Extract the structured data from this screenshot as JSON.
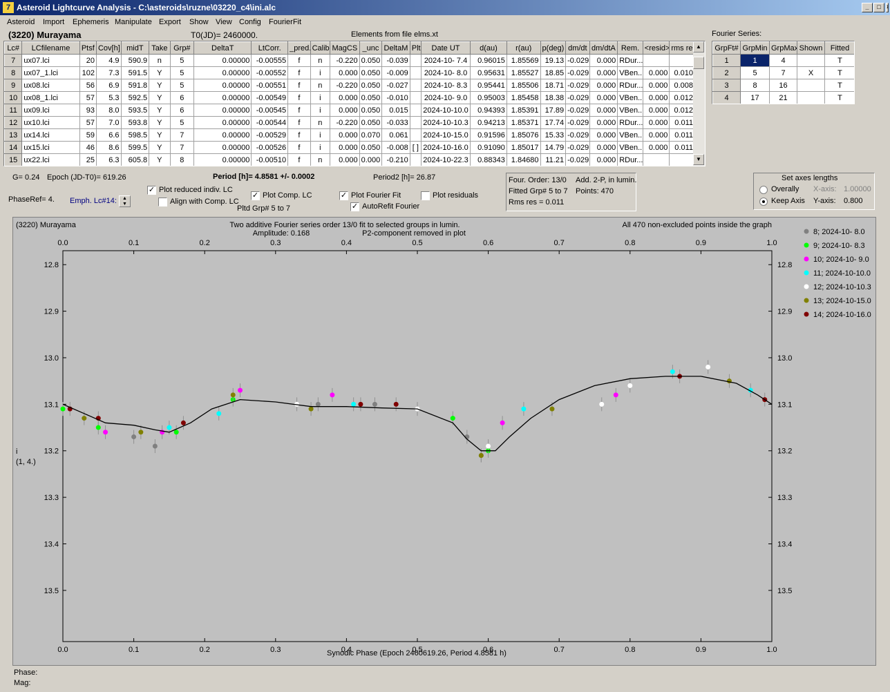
{
  "window": {
    "title": "Asteroid Lightcurve Analysis - C:\\asteroids\\ruzne\\03220_c4\\ini.alc",
    "icon_glyph": "7",
    "buttons": [
      "_",
      "□",
      "×"
    ]
  },
  "menu": [
    "Asteroid",
    "Import",
    "Ephemeris",
    "Manipulate",
    "Export",
    "Show",
    "View",
    "Config",
    "FourierFit"
  ],
  "header": {
    "asteroid": "(3220) Murayama",
    "t0": "T0(JD)= 2460000.",
    "elements": "Elements from file elms.xt",
    "fourier_label": "Fourier Series:"
  },
  "table": {
    "columns": [
      "Lc#",
      "LCfilename",
      "Ptsf",
      "Cov[h]",
      "midT",
      "Take",
      "Grp#",
      "DeltaT",
      "LtCorr.",
      "_pred.",
      "Calib.",
      "MagCS",
      "_unc",
      "DeltaM",
      "Plt",
      "Date UT",
      "d(au)",
      "r(au)",
      "p(deg)",
      "dm/dt",
      "dm/dtA",
      "Rem.",
      "<resid>",
      "rms res"
    ],
    "rows": [
      [
        "7",
        "ux07.lci",
        "20",
        "4.9",
        "590.9",
        "n",
        "5",
        "0.00000",
        "-0.00555",
        "f",
        "n",
        "-0.220",
        "0.050",
        "-0.039",
        "",
        "2024-10- 7.4",
        "0.96015",
        "1.85569",
        "19.13",
        "-0.029",
        "0.000",
        "RDur...",
        "",
        ""
      ],
      [
        "8",
        "ux07_1.lci",
        "102",
        "7.3",
        "591.5",
        "Y",
        "5",
        "0.00000",
        "-0.00552",
        "f",
        "i",
        "0.000",
        "0.050",
        "-0.009",
        "",
        "2024-10- 8.0",
        "0.95631",
        "1.85527",
        "18.85",
        "-0.029",
        "0.000",
        "VBen...",
        "0.000",
        "0.010"
      ],
      [
        "9",
        "ux08.lci",
        "56",
        "6.9",
        "591.8",
        "Y",
        "5",
        "0.00000",
        "-0.00551",
        "f",
        "n",
        "-0.220",
        "0.050",
        "-0.027",
        "",
        "2024-10- 8.3",
        "0.95441",
        "1.85506",
        "18.71",
        "-0.029",
        "0.000",
        "RDur...",
        "0.000",
        "0.008"
      ],
      [
        "10",
        "ux08_1.lci",
        "57",
        "5.3",
        "592.5",
        "Y",
        "6",
        "0.00000",
        "-0.00549",
        "f",
        "i",
        "0.000",
        "0.050",
        "-0.010",
        "",
        "2024-10- 9.0",
        "0.95003",
        "1.85458",
        "18.38",
        "-0.029",
        "0.000",
        "VBen...",
        "0.000",
        "0.012"
      ],
      [
        "11",
        "ux09.lci",
        "93",
        "8.0",
        "593.5",
        "Y",
        "6",
        "0.00000",
        "-0.00545",
        "f",
        "i",
        "0.000",
        "0.050",
        "0.015",
        "",
        "2024-10-10.0",
        "0.94393",
        "1.85391",
        "17.89",
        "-0.029",
        "0.000",
        "VBen...",
        "0.000",
        "0.012"
      ],
      [
        "12",
        "ux10.lci",
        "57",
        "7.0",
        "593.8",
        "Y",
        "5",
        "0.00000",
        "-0.00544",
        "f",
        "n",
        "-0.220",
        "0.050",
        "-0.033",
        "",
        "2024-10-10.3",
        "0.94213",
        "1.85371",
        "17.74",
        "-0.029",
        "0.000",
        "RDur...",
        "0.000",
        "0.011"
      ],
      [
        "13",
        "ux14.lci",
        "59",
        "6.6",
        "598.5",
        "Y",
        "7",
        "0.00000",
        "-0.00529",
        "f",
        "i",
        "0.000",
        "0.070",
        "0.061",
        "",
        "2024-10-15.0",
        "0.91596",
        "1.85076",
        "15.33",
        "-0.029",
        "0.000",
        "VBen...",
        "0.000",
        "0.011"
      ],
      [
        "14",
        "ux15.lci",
        "46",
        "8.6",
        "599.5",
        "Y",
        "7",
        "0.00000",
        "-0.00526",
        "f",
        "i",
        "0.000",
        "0.050",
        "-0.008",
        "[ ]",
        "2024-10-16.0",
        "0.91090",
        "1.85017",
        "14.79",
        "-0.029",
        "0.000",
        "VBen...",
        "0.000",
        "0.011"
      ],
      [
        "15",
        "ux22.lci",
        "25",
        "6.3",
        "605.8",
        "Y",
        "8",
        "0.00000",
        "-0.00510",
        "f",
        "n",
        "0.000",
        "0.000",
        "-0.210",
        "",
        "2024-10-22.3",
        "0.88343",
        "1.84680",
        "11.21",
        "-0.029",
        "0.000",
        "RDur...",
        "",
        ""
      ]
    ]
  },
  "fourier_table": {
    "columns": [
      "GrpFt#",
      "GrpMin",
      "GrpMax",
      "Shown",
      "Fitted"
    ],
    "rows": [
      [
        "1",
        "1",
        "4",
        "",
        "T"
      ],
      [
        "2",
        "5",
        "7",
        "X",
        "T"
      ],
      [
        "3",
        "8",
        "16",
        "",
        "T"
      ],
      [
        "4",
        "17",
        "21",
        "",
        "T"
      ]
    ]
  },
  "controls": {
    "g": "G= 0.24",
    "epoch": "Epoch (JD-T0)= 619.26",
    "period": "Period [h]= 4.8581 +/- 0.0002",
    "period2": "Period2 [h]= 26.87",
    "phaseref": "PhaseRef= 4.",
    "emph": "Emph. Lc#14:",
    "plot_reduced": "Plot reduced indiv. LC",
    "align": "Align with Comp. LC",
    "plot_comp": "Plot Comp. LC",
    "pltd": "Pltd Grp#  5  to  7",
    "plot_fourier": "Plot Fourier Fit",
    "autorefit": "AutoRefit Fourier",
    "plot_residuals": "Plot residuals",
    "info": [
      "Four. Order: 13/0",
      "Add. 2-P, in lumin.",
      "Fitted Grp# 5 to 7",
      "Points: 470",
      "Rms res      = 0.011"
    ],
    "axes": {
      "title": "Set axes lengths",
      "overall": "Overally",
      "keep": "Keep Axis",
      "xaxis_label": "X-axis:",
      "xaxis_val": "1.00000",
      "yaxis_label": "Y-axis:",
      "yaxis_val": "0.800"
    }
  },
  "plot": {
    "top_left": "(3220) Murayama",
    "title1": "Two additive Fourier series order 13/0 fit to selected groups in lumin.",
    "title2a": "Amplitude: 0.168",
    "title2b": "P2-component removed in plot",
    "top_right": "All 470 non-excluded points inside the graph",
    "ylabel1": "i",
    "ylabel2": "(1, 4.)",
    "xlabel": "Synodic Phase (Epoch 2460619.26, Period 4.8581 h)",
    "phase_label": "Phase:",
    "mag_label": "Mag:"
  },
  "chart_data": {
    "type": "scatter",
    "xlim": [
      0,
      1
    ],
    "ylim": [
      13.6,
      12.8
    ],
    "x_ticks": [
      "0.0",
      "0.1",
      "0.2",
      "0.3",
      "0.4",
      "0.5",
      "0.6",
      "0.7",
      "0.8",
      "0.9",
      "1.0"
    ],
    "y_ticks": [
      "12.8",
      "12.9",
      "13.0",
      "13.1",
      "13.2",
      "13.3",
      "13.4",
      "13.5"
    ],
    "legend_placement": "right",
    "series": [
      {
        "name": "8; 2024-10- 8.0",
        "color": "#808080",
        "x": [
          0.1,
          0.13,
          0.36,
          0.44,
          0.57,
          0.59
        ],
        "y": [
          13.17,
          13.19,
          13.1,
          13.1,
          13.17,
          13.21
        ]
      },
      {
        "name": "9; 2024-10- 8.3",
        "color": "#00ff00",
        "x": [
          0.0,
          0.05,
          0.16,
          0.24,
          0.55,
          0.6
        ],
        "y": [
          13.11,
          13.15,
          13.16,
          13.09,
          13.13,
          13.2
        ]
      },
      {
        "name": "10; 2024-10- 9.0",
        "color": "#ff00ff",
        "x": [
          0.06,
          0.14,
          0.25,
          0.38,
          0.62,
          0.78
        ],
        "y": [
          13.16,
          13.16,
          13.07,
          13.08,
          13.14,
          13.08
        ]
      },
      {
        "name": "11; 2024-10-10.0",
        "color": "#00ffff",
        "x": [
          0.15,
          0.22,
          0.41,
          0.65,
          0.86,
          0.97
        ],
        "y": [
          13.15,
          13.12,
          13.1,
          13.11,
          13.03,
          13.07
        ]
      },
      {
        "name": "12; 2024-10-10.3",
        "color": "#ffffff",
        "x": [
          0.33,
          0.5,
          0.6,
          0.76,
          0.8,
          0.91
        ],
        "y": [
          13.1,
          13.11,
          13.19,
          13.1,
          13.06,
          13.02
        ]
      },
      {
        "name": "13; 2024-10-15.0",
        "color": "#808000",
        "x": [
          0.03,
          0.11,
          0.24,
          0.35,
          0.59,
          0.69,
          0.94
        ],
        "y": [
          13.13,
          13.16,
          13.08,
          13.11,
          13.21,
          13.11,
          13.05
        ]
      },
      {
        "name": "14; 2024-10-16.0",
        "color": "#800000",
        "x": [
          0.01,
          0.05,
          0.17,
          0.42,
          0.47,
          0.87,
          0.99
        ],
        "y": [
          13.11,
          13.13,
          13.14,
          13.1,
          13.1,
          13.04,
          13.09
        ]
      }
    ],
    "fit_curve": {
      "x": [
        0.0,
        0.03,
        0.06,
        0.1,
        0.13,
        0.15,
        0.18,
        0.21,
        0.25,
        0.3,
        0.35,
        0.4,
        0.45,
        0.5,
        0.55,
        0.57,
        0.59,
        0.61,
        0.63,
        0.66,
        0.7,
        0.75,
        0.8,
        0.85,
        0.9,
        0.95,
        0.98,
        1.0
      ],
      "y": [
        13.1,
        13.12,
        13.14,
        13.145,
        13.155,
        13.16,
        13.14,
        13.11,
        13.09,
        13.095,
        13.105,
        13.105,
        13.108,
        13.11,
        13.14,
        13.175,
        13.2,
        13.2,
        13.17,
        13.13,
        13.09,
        13.06,
        13.045,
        13.04,
        13.04,
        13.055,
        13.08,
        13.1
      ]
    }
  }
}
